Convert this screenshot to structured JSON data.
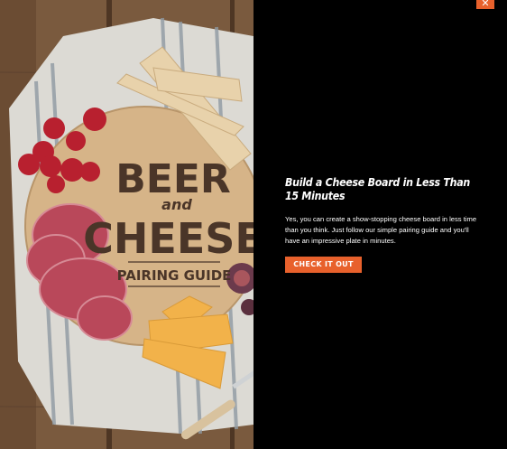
{
  "image": {
    "cover_title_line1": "BEER",
    "cover_title_line2": "and",
    "cover_title_line3": "CHEESE",
    "cover_subtitle": "PAIRING GUIDE"
  },
  "content": {
    "headline": "Build a Cheese Board in Less Than 15 Minutes",
    "body": "Yes, you can create a show-stopping cheese board in less time than you think. Just follow our simple pairing guide and you'll have an impressive plate in minutes.",
    "cta_label": "CHECK IT OUT"
  },
  "close": {
    "label": "✕"
  },
  "colors": {
    "accent": "#e8612c",
    "background": "#000000"
  }
}
